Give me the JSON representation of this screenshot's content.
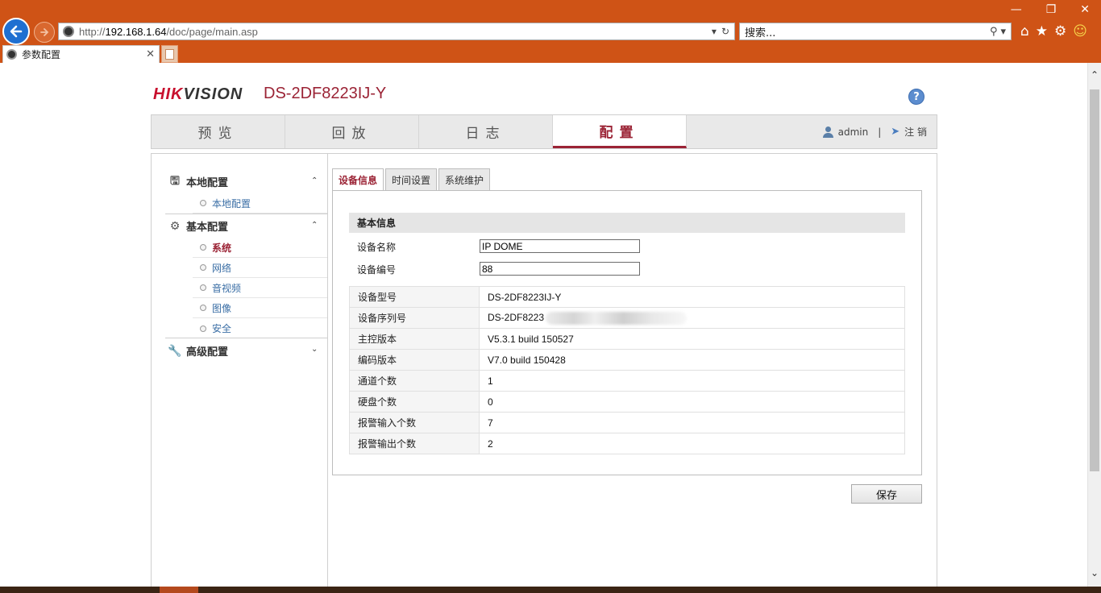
{
  "browser": {
    "url_prefix": "http://",
    "url_host": "192.168.1.64",
    "url_path": "/doc/page/main.asp",
    "search_placeholder": "搜索...",
    "tab_title": "参数配置"
  },
  "header": {
    "brand_hik": "HIK",
    "brand_vision": "VISION",
    "model": "DS-2DF8223IJ-Y",
    "help": "?"
  },
  "mainnav": {
    "tabs": [
      "预览",
      "回放",
      "日志",
      "配置"
    ],
    "active": "配置",
    "user": "admin",
    "separator": "|",
    "logout": "注 销"
  },
  "sidebar": {
    "groups": [
      {
        "label": "本地配置",
        "items": [
          "本地配置"
        ]
      },
      {
        "label": "基本配置",
        "items": [
          "系统",
          "网络",
          "音视频",
          "图像",
          "安全"
        ]
      },
      {
        "label": "高级配置",
        "items": []
      }
    ],
    "active_item": "系统"
  },
  "subtabs": [
    "设备信息",
    "时间设置",
    "系统维护"
  ],
  "basic_info": {
    "title": "基本信息",
    "device_name_label": "设备名称",
    "device_name_value": "IP DOME",
    "device_no_label": "设备编号",
    "device_no_value": "88"
  },
  "info_rows": [
    {
      "k": "设备型号",
      "v": "DS-2DF8223IJ-Y"
    },
    {
      "k": "设备序列号",
      "v": "DS-2DF8223"
    },
    {
      "k": "主控版本",
      "v": "V5.3.1 build 150527"
    },
    {
      "k": "编码版本",
      "v": "V7.0 build 150428"
    },
    {
      "k": "通道个数",
      "v": "1"
    },
    {
      "k": "硬盘个数",
      "v": "0"
    },
    {
      "k": "报警输入个数",
      "v": "7"
    },
    {
      "k": "报警输出个数",
      "v": "2"
    }
  ],
  "save_label": "保存"
}
